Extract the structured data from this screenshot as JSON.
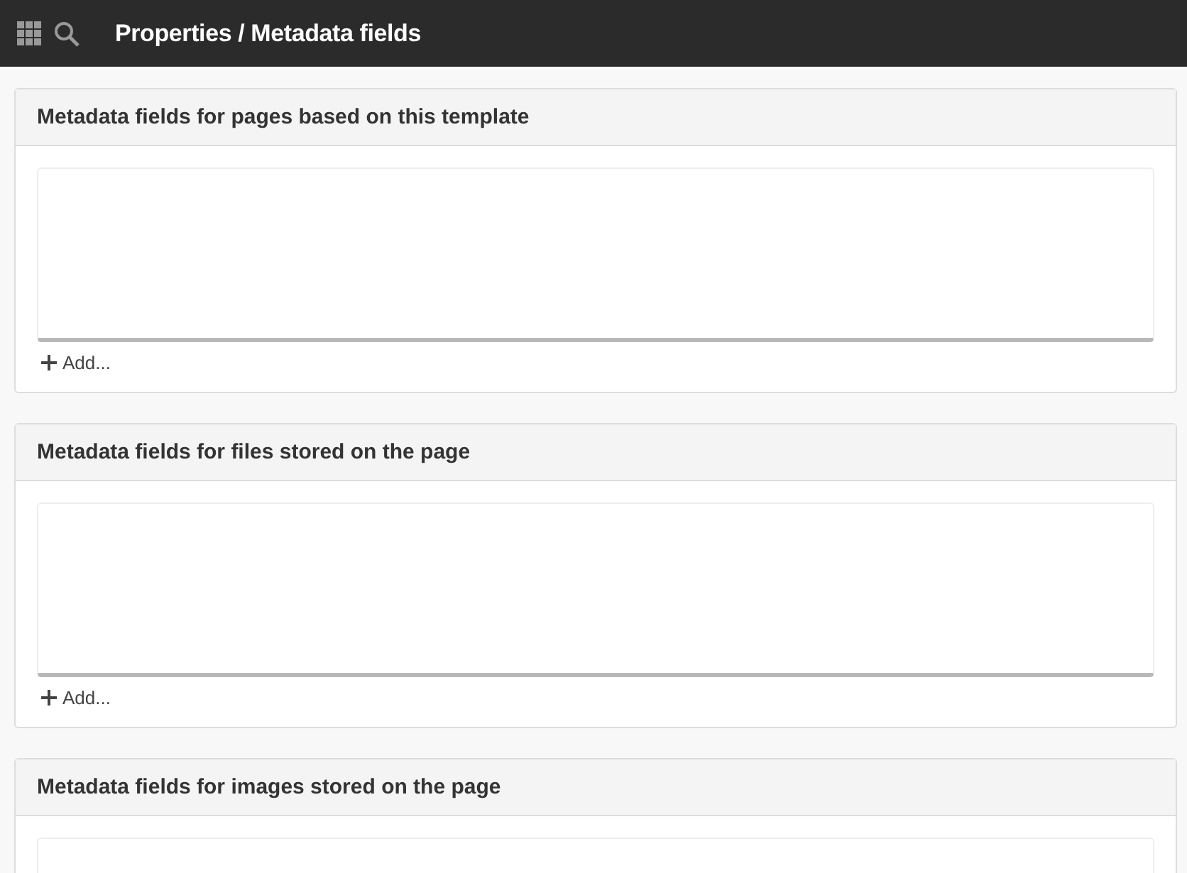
{
  "topbar": {
    "title": "Properties / Metadata fields"
  },
  "panels": [
    {
      "title": "Metadata fields for pages based on this template",
      "add_label": "Add..."
    },
    {
      "title": "Metadata fields for files stored on the page",
      "add_label": "Add..."
    },
    {
      "title": "Metadata fields for images stored on the page"
    }
  ]
}
